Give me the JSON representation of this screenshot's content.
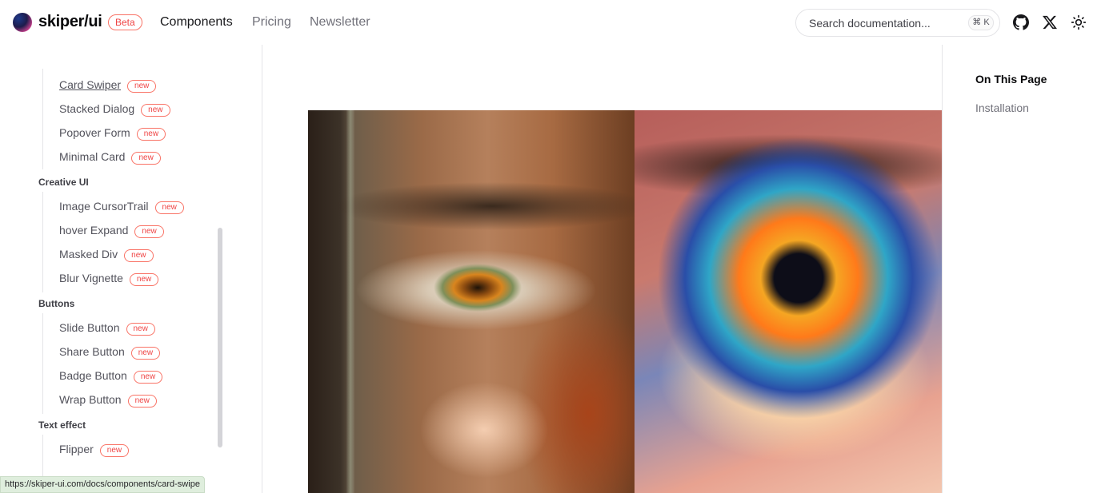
{
  "header": {
    "brand": "skiper/ui",
    "beta": "Beta",
    "nav": [
      "Components",
      "Pricing",
      "Newsletter"
    ],
    "search_placeholder": "Search documentation...",
    "shortcut": "⌘ K"
  },
  "sidebar": {
    "badge": "new",
    "top_items": [
      {
        "label": "Card Swiper",
        "current": true
      },
      {
        "label": "Stacked Dialog"
      },
      {
        "label": "Popover Form"
      },
      {
        "label": "Minimal Card"
      }
    ],
    "groups": [
      {
        "title": "Creative UI",
        "items": [
          "Image CursorTrail",
          "hover Expand",
          "Masked Div",
          "Blur Vignette"
        ]
      },
      {
        "title": "Buttons",
        "items": [
          "Slide Button",
          "Share Button",
          "Badge Button",
          "Wrap Button"
        ]
      },
      {
        "title": "Text effect",
        "items": [
          "Flipper"
        ]
      }
    ]
  },
  "status_url": "https://skiper-ui.com/docs/components/card-swipe",
  "toc": {
    "title": "On This Page",
    "links": [
      "Installation"
    ]
  },
  "icons": {
    "github": "github-icon",
    "x": "x-icon",
    "theme": "sun-icon"
  }
}
